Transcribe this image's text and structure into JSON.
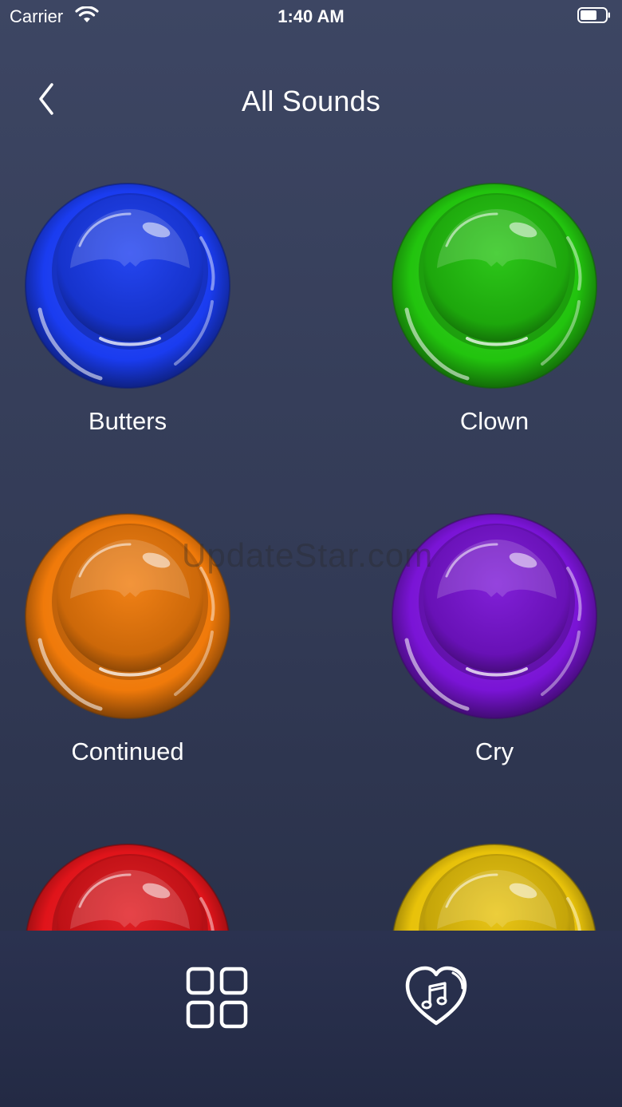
{
  "status_bar": {
    "carrier": "Carrier",
    "time": "1:40 AM",
    "wifi_icon": "wifi-icon",
    "battery_icon": "battery-icon"
  },
  "nav": {
    "title": "All Sounds",
    "back_icon": "chevron-left-icon"
  },
  "sounds": [
    {
      "label": "Butters",
      "color": "#1a3cf0"
    },
    {
      "label": "Clown",
      "color": "#22c40e"
    },
    {
      "label": "Continued",
      "color": "#f07a0a"
    },
    {
      "label": "Cry",
      "color": "#7a14d6"
    },
    {
      "label": "",
      "color": "#e0141a"
    },
    {
      "label": "",
      "color": "#e8c20a"
    }
  ],
  "watermark": "UpdateStar.com",
  "tab_bar": {
    "grid_icon": "grid-icon",
    "favorites_icon": "heart-music-icon"
  },
  "colors": {
    "background_top": "#3d4663",
    "background_bottom": "#262d45",
    "text": "#ffffff"
  }
}
